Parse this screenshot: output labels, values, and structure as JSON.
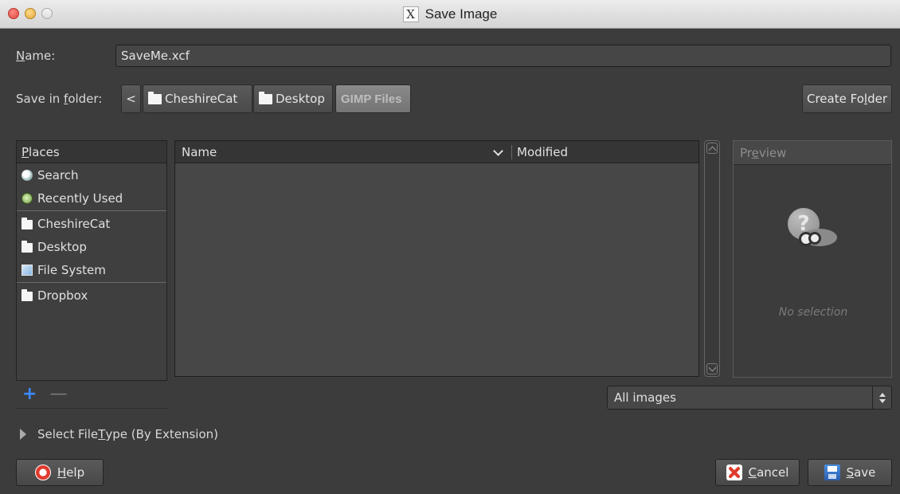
{
  "window": {
    "title": "Save Image",
    "app_icon": "X"
  },
  "name_row": {
    "label_first": "N",
    "label_rest": "ame:",
    "value": "SaveMe.xcf"
  },
  "folder_row": {
    "label_pre": "Save in ",
    "label_u": "f",
    "label_post": "older:",
    "back_glyph": "<",
    "crumbs": [
      "CheshireCat",
      "Desktop",
      "GIMP Files"
    ],
    "create_pre": "Create Fo",
    "create_u": "l",
    "create_post": "der"
  },
  "places": {
    "header_u": "P",
    "header_rest": "laces",
    "items": [
      {
        "label": "Search",
        "icon": "search-icon"
      },
      {
        "label": "Recently Used",
        "icon": "recent-icon"
      },
      {
        "label": "CheshireCat",
        "icon": "folder-icon"
      },
      {
        "label": "Desktop",
        "icon": "folder-icon"
      },
      {
        "label": "File System",
        "icon": "filesystem-icon"
      },
      {
        "label": "Dropbox",
        "icon": "folder-icon"
      }
    ],
    "add": "+",
    "remove": "—"
  },
  "file_list": {
    "col_name": "Name",
    "col_modified": "Modified"
  },
  "preview": {
    "header_pre": "Pr",
    "header_u": "e",
    "header_post": "view",
    "question": "?",
    "empty_text": "No selection"
  },
  "filter": {
    "selected": "All images"
  },
  "expander": {
    "pre": "Select File ",
    "u": "T",
    "post": "ype (By Extension)"
  },
  "buttons": {
    "help_u": "H",
    "help_rest": "elp",
    "cancel_u": "C",
    "cancel_rest": "ancel",
    "save_u": "S",
    "save_rest": "ave"
  },
  "colors": {
    "dialog_bg": "#3c3c3c",
    "accent_blue": "#3b8cff",
    "danger_red": "#e03a2e"
  }
}
